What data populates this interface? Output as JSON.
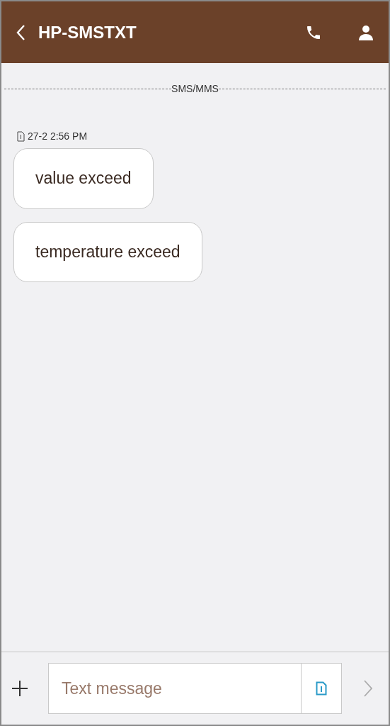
{
  "header": {
    "title": "HP-SMSTXT"
  },
  "divider": {
    "label": "SMS/MMS"
  },
  "timestamp": "27-2 2:56 PM",
  "messages": [
    {
      "text": "value exceed"
    },
    {
      "text": "temperature exceed"
    }
  ],
  "composer": {
    "placeholder": "Text message"
  }
}
